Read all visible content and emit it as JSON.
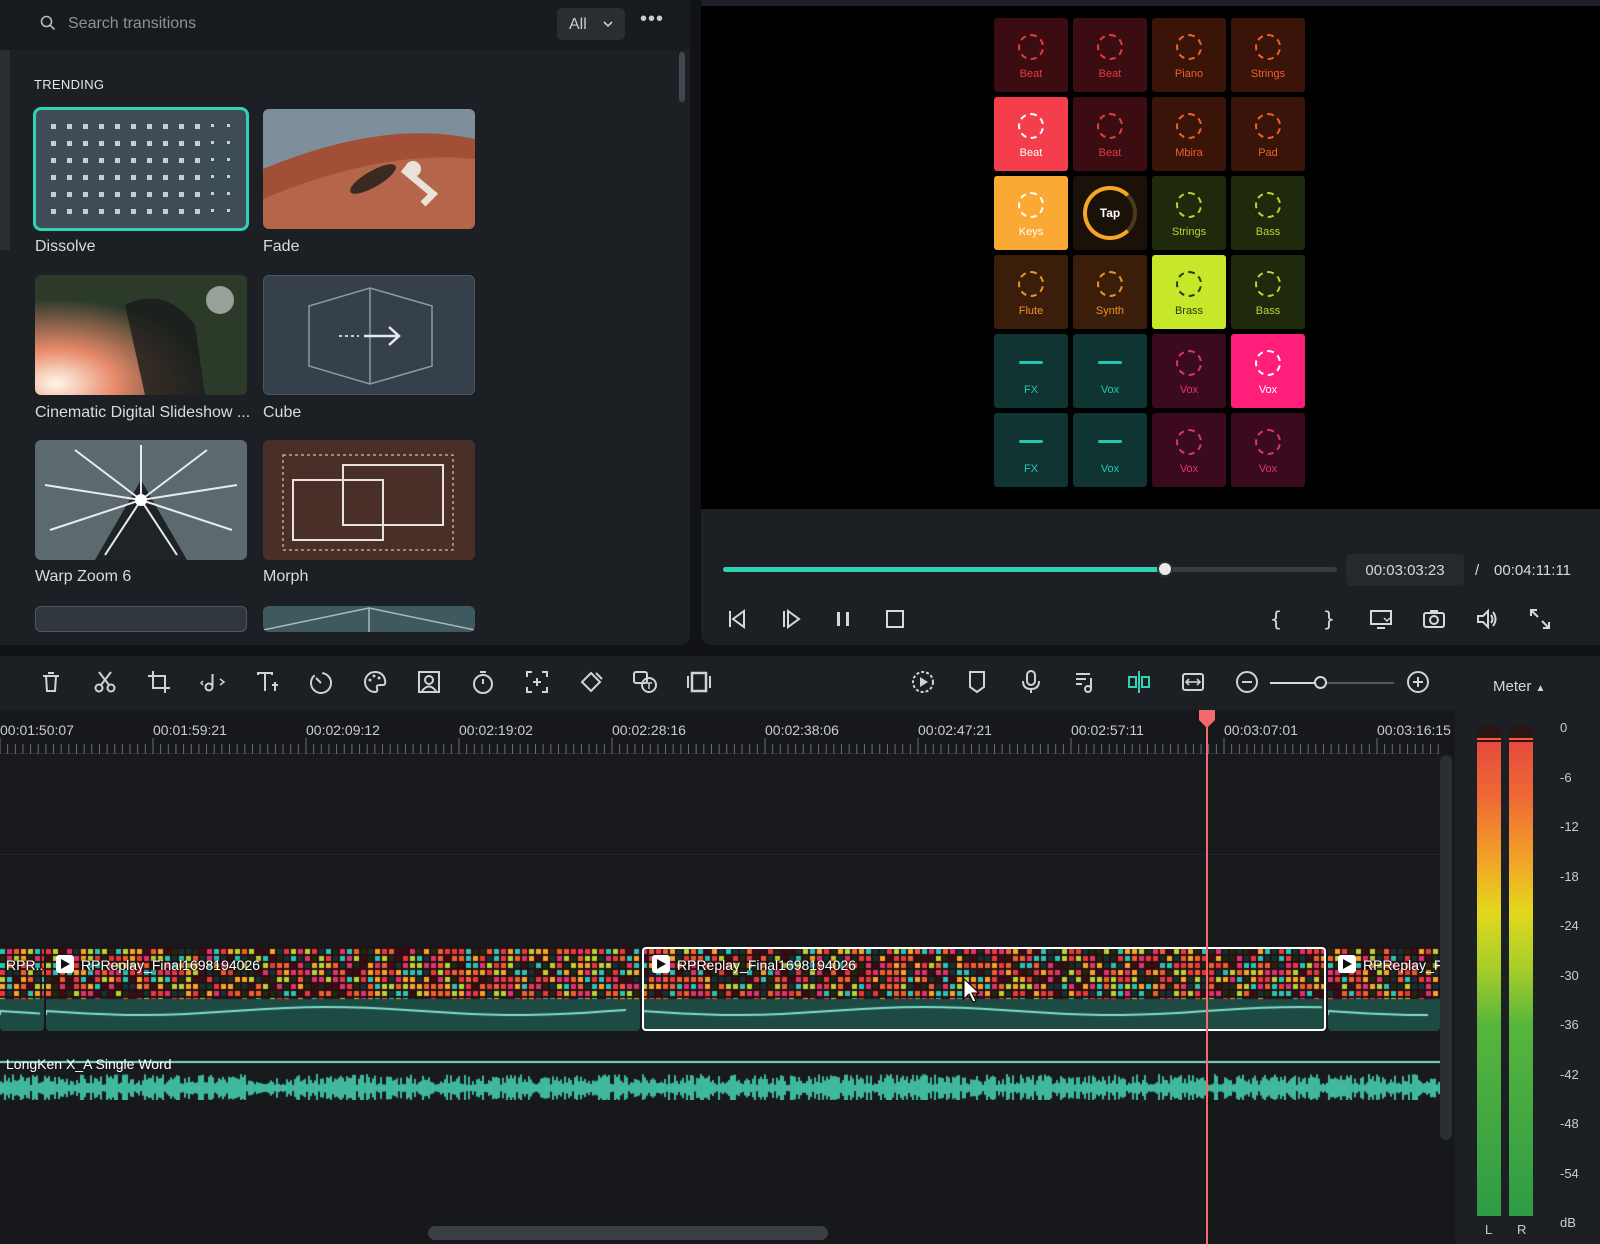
{
  "transitions": {
    "search_placeholder": "Search transitions",
    "filter_value": "All",
    "section_title": "TRENDING",
    "items": [
      {
        "label": "Dissolve",
        "selected": true
      },
      {
        "label": "Fade"
      },
      {
        "label": "Cinematic Digital Slideshow ..."
      },
      {
        "label": "Cube"
      },
      {
        "label": "Warp Zoom 6"
      },
      {
        "label": "Morph"
      }
    ]
  },
  "preview": {
    "pads": [
      [
        "Beat",
        "Beat",
        "Piano",
        "Strings"
      ],
      [
        "Beat",
        "Beat",
        "Mbira",
        "Pad"
      ],
      [
        "Keys",
        "Tap",
        "Strings",
        "Bass"
      ],
      [
        "Flute",
        "Synth",
        "Brass",
        "Bass"
      ],
      [
        "FX",
        "Vox",
        "Vox",
        "Vox"
      ],
      [
        "FX",
        "Vox",
        "Vox",
        "Vox"
      ]
    ],
    "current_time": "00:03:03:23",
    "separator": "/",
    "total_time": "00:04:11:11",
    "progress_fraction": 0.72,
    "accent_color": "#32d1b6"
  },
  "toolbar": {
    "icons": [
      "trash-icon",
      "scissors-icon",
      "crop-icon",
      "audio-icon",
      "text-icon",
      "speed-icon",
      "color-icon",
      "masking-icon",
      "timer-icon",
      "auto-reframe-icon",
      "keyframe-icon",
      "speech-to-text-icon",
      "split-screen-icon"
    ],
    "right_icons": [
      "render-icon",
      "marker-icon",
      "microphone-icon",
      "audio-mix-icon",
      "snap-icon",
      "fit-icon",
      "zoom-out-icon",
      "zoom-in-icon"
    ],
    "zoom_fraction": 0.42
  },
  "timeline": {
    "ticks": [
      "00:01:50:07",
      "00:01:59:21",
      "00:02:09:12",
      "00:02:19:02",
      "00:02:28:16",
      "00:02:38:06",
      "00:02:47:21",
      "00:02:57:11",
      "00:03:07:01",
      "00:03:16:15"
    ],
    "clips": [
      {
        "name": "RPR..."
      },
      {
        "name": "RPReplay_Final1698194026"
      },
      {
        "name": "RPReplay_Final1698194026",
        "selected": true
      },
      {
        "name": "RPReplay_F"
      }
    ],
    "audio_track": "LongKen X_A Single Word",
    "playhead_color": "#f26a6a"
  },
  "meter": {
    "title": "Meter",
    "db_labels": [
      "0",
      "-6",
      "-12",
      "-18",
      "-24",
      "-30",
      "-36",
      "-42",
      "-48",
      "-54",
      "dB"
    ],
    "channels": [
      "L",
      "R"
    ]
  }
}
